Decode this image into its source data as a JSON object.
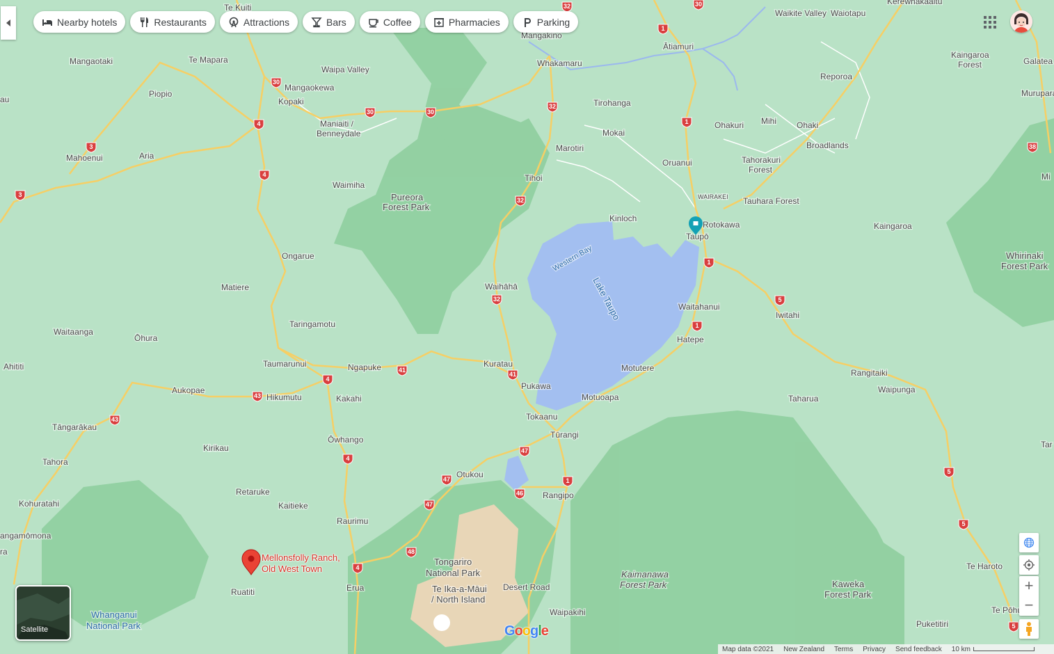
{
  "chips": [
    {
      "label": "Nearby hotels",
      "icon": "bed-icon"
    },
    {
      "label": "Restaurants",
      "icon": "fork-knife-icon"
    },
    {
      "label": "Attractions",
      "icon": "ferris-wheel-icon"
    },
    {
      "label": "Bars",
      "icon": "cocktail-icon"
    },
    {
      "label": "Coffee",
      "icon": "coffee-cup-icon"
    },
    {
      "label": "Pharmacies",
      "icon": "pharmacy-icon"
    },
    {
      "label": "Parking",
      "icon": "parking-icon"
    }
  ],
  "pin": {
    "line1": "Mellonsfolly Ranch,",
    "line2": "Old West Town"
  },
  "satellite_label": "Satellite",
  "footer": {
    "map_data": "Map data ©2021",
    "region": "New Zealand",
    "terms": "Terms",
    "privacy": "Privacy",
    "feedback": "Send feedback",
    "scale": "10 km"
  },
  "logo": "Google",
  "colors": {
    "land": "#b9e2c6",
    "forest": "#8fcf9f",
    "water": "#a3bff0",
    "highway": "#f6cf65",
    "shield": "#d93f3f",
    "pin": "#ea4335",
    "taupo_pin": "#13a1b5"
  },
  "places": [
    {
      "name": "Te Kuiti"
    },
    {
      "name": "Mangaotaki"
    },
    {
      "name": "Te Mapara"
    },
    {
      "name": "Waipa Valley"
    },
    {
      "name": "Mangaokewa"
    },
    {
      "name": "Piopio"
    },
    {
      "name": "Kopaki"
    },
    {
      "name": "Maniaiti /"
    },
    {
      "name": "Benneydale"
    },
    {
      "name": "Mahoenui"
    },
    {
      "name": "Aria"
    },
    {
      "name": "Waimiha"
    },
    {
      "name": "Pureora"
    },
    {
      "name": "Forest Park"
    },
    {
      "name": "Ongarue"
    },
    {
      "name": "Matiere"
    },
    {
      "name": "Taringamotu"
    },
    {
      "name": "Waitaanga"
    },
    {
      "name": "Ōhura"
    },
    {
      "name": "Ahititi"
    },
    {
      "name": "Taumarunui"
    },
    {
      "name": "Ngapuke"
    },
    {
      "name": "Aukopae"
    },
    {
      "name": "Hikumutu"
    },
    {
      "name": "Kakahi"
    },
    {
      "name": "Tāngarākau"
    },
    {
      "name": "Kirikau"
    },
    {
      "name": "Tahora"
    },
    {
      "name": "Ōwhango"
    },
    {
      "name": "Kohuratahi"
    },
    {
      "name": "Retaruke"
    },
    {
      "name": "Kaitieke"
    },
    {
      "name": "Raurimu"
    },
    {
      "name": "angamōmona"
    },
    {
      "name": "Ruatiti"
    },
    {
      "name": "Erua"
    },
    {
      "name": "Whanganui"
    },
    {
      "name": "National Park"
    },
    {
      "name": "Mangakino"
    },
    {
      "name": "Whakamaru"
    },
    {
      "name": "Tirohanga"
    },
    {
      "name": "Mokai"
    },
    {
      "name": "Marotiri"
    },
    {
      "name": "Tihoi"
    },
    {
      "name": "Waihāhā"
    },
    {
      "name": "Kuratau"
    },
    {
      "name": "Pukawa"
    },
    {
      "name": "Tokaanu"
    },
    {
      "name": "Tūrangi"
    },
    {
      "name": "Motuoapa"
    },
    {
      "name": "Motutere"
    },
    {
      "name": "Hatepe"
    },
    {
      "name": "Waitahanui"
    },
    {
      "name": "Kinloch"
    },
    {
      "name": "Western Bay"
    },
    {
      "name": "Lake Taupo"
    },
    {
      "name": "Taupō"
    },
    {
      "name": "Rotokawa"
    },
    {
      "name": "WAIRAKEI"
    },
    {
      "name": "Oruanui"
    },
    {
      "name": "Ātiamuri"
    },
    {
      "name": "Waikite Valley"
    },
    {
      "name": "Waiotapu"
    },
    {
      "name": "Kerewhakaaitu"
    },
    {
      "name": "Kaingaroa"
    },
    {
      "name": "Forest"
    },
    {
      "name": "Reporoa"
    },
    {
      "name": "Ohakuri"
    },
    {
      "name": "Mihi"
    },
    {
      "name": "Ohaki"
    },
    {
      "name": "Broadlands"
    },
    {
      "name": "Tahorakuri"
    },
    {
      "name": "Forest"
    },
    {
      "name": "Tauhara Forest"
    },
    {
      "name": "Kaingaroa"
    },
    {
      "name": "Galatea"
    },
    {
      "name": "Murupara"
    },
    {
      "name": "Whirinaki"
    },
    {
      "name": "Forest Park"
    },
    {
      "name": "Iwitahi"
    },
    {
      "name": "Rangitaiki"
    },
    {
      "name": "Waipunga"
    },
    {
      "name": "Taharua"
    },
    {
      "name": "Otukou"
    },
    {
      "name": "Rangipo"
    },
    {
      "name": "Tongariro"
    },
    {
      "name": "National Park"
    },
    {
      "name": "Te Ika-a-Māui"
    },
    {
      "name": "/ North Island"
    },
    {
      "name": "Desert Road"
    },
    {
      "name": "Waipakihi"
    },
    {
      "name": "Kaimanawa"
    },
    {
      "name": "Forest Park"
    },
    {
      "name": "Kaweka"
    },
    {
      "name": "Forest Park"
    },
    {
      "name": "Te Haroto"
    },
    {
      "name": "Te Pōhue"
    },
    {
      "name": "Puketitiri"
    },
    {
      "name": "Mi"
    },
    {
      "name": "Tar"
    },
    {
      "name": "au"
    },
    {
      "name": "ra"
    }
  ],
  "shields": [
    "32",
    "30",
    "1",
    "30",
    "30",
    "30",
    "4",
    "3",
    "4",
    "3",
    "32",
    "32",
    "32",
    "41",
    "41",
    "4",
    "43",
    "43",
    "4",
    "47",
    "47",
    "46",
    "47",
    "48",
    "4",
    "1",
    "1",
    "1",
    "1",
    "5",
    "5",
    "5",
    "5",
    "38"
  ]
}
